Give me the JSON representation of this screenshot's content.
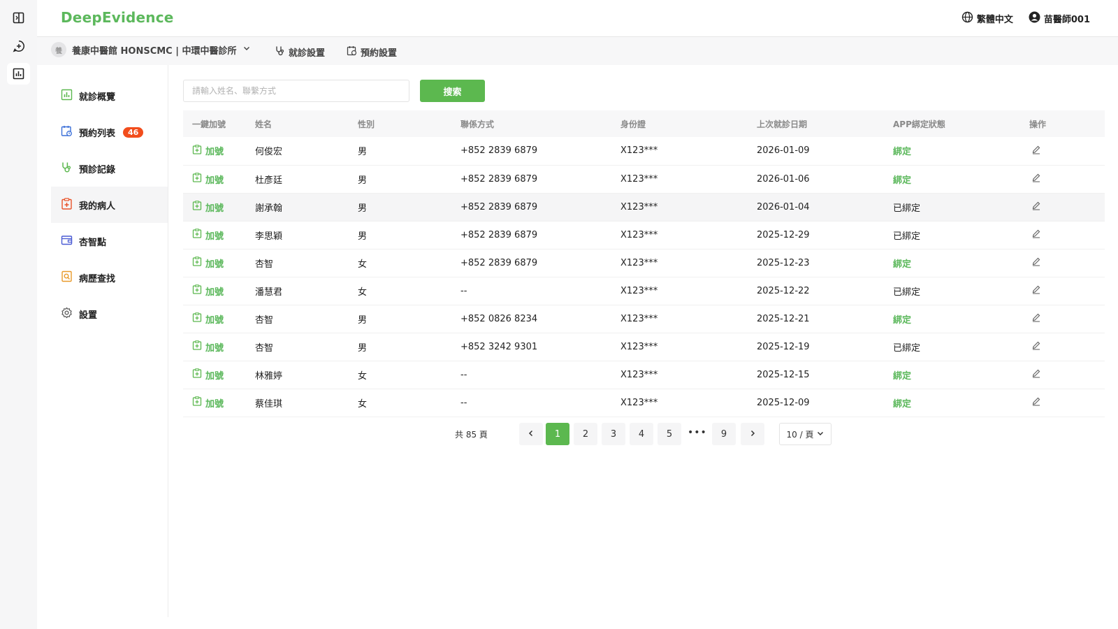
{
  "app": {
    "brand": "DeepEvidence"
  },
  "rail": {
    "items": [
      "panel-toggle-icon",
      "new-chat-icon",
      "chart-icon"
    ],
    "active": 2
  },
  "topbar": {
    "language": "繁體中文",
    "user": "苗醫師001"
  },
  "subbar": {
    "clinic": "養康中醫館 HONSCMC | 中環中醫診所",
    "clinic_logo": "養",
    "visit_settings": "就診設置",
    "appointment_settings": "預約設置"
  },
  "sidebar": {
    "items": [
      {
        "label": "就診概覽",
        "icon": "chart-icon"
      },
      {
        "label": "預約列表",
        "icon": "calendar-icon",
        "badge": "46"
      },
      {
        "label": "預診記錄",
        "icon": "stethoscope-icon"
      },
      {
        "label": "我的病人",
        "icon": "clipboard-plus-icon",
        "active": true
      },
      {
        "label": "杏智點",
        "icon": "wallet-icon"
      },
      {
        "label": "病歷查找",
        "icon": "document-search-icon"
      },
      {
        "label": "設置",
        "icon": "gear-icon"
      }
    ]
  },
  "search": {
    "placeholder": "請輸入姓名、聯繫方式",
    "button": "搜索"
  },
  "table": {
    "headers": [
      "一鍵加號",
      "姓名",
      "性別",
      "聯係方式",
      "身份證",
      "上次就診日期",
      "APP綁定狀態",
      "操作"
    ],
    "add_label": "加號",
    "rows": [
      {
        "name": "何俊宏",
        "gender": "男",
        "phone": "+852 2839 6879",
        "id": "X123***",
        "last_visit": "2026-01-09",
        "status": "綁定",
        "bound": false
      },
      {
        "name": "杜彥廷",
        "gender": "男",
        "phone": "+852 2839 6879",
        "id": "X123***",
        "last_visit": "2026-01-06",
        "status": "綁定",
        "bound": false
      },
      {
        "name": "謝承翰",
        "gender": "男",
        "phone": "+852 2839 6879",
        "id": "X123***",
        "last_visit": "2026-01-04",
        "status": "已綁定",
        "bound": true
      },
      {
        "name": "李思穎",
        "gender": "男",
        "phone": "+852 2839 6879",
        "id": "X123***",
        "last_visit": "2025-12-29",
        "status": "已綁定",
        "bound": true
      },
      {
        "name": "杏智",
        "gender": "女",
        "phone": "+852 2839 6879",
        "id": "X123***",
        "last_visit": "2025-12-23",
        "status": "綁定",
        "bound": false
      },
      {
        "name": "潘慧君",
        "gender": "女",
        "phone": "--",
        "id": "X123***",
        "last_visit": "2025-12-22",
        "status": "已綁定",
        "bound": true
      },
      {
        "name": "杏智",
        "gender": "男",
        "phone": "+852 0826 8234",
        "id": "X123***",
        "last_visit": "2025-12-21",
        "status": "綁定",
        "bound": false
      },
      {
        "name": "杏智",
        "gender": "男",
        "phone": "+852 3242 9301",
        "id": "X123***",
        "last_visit": "2025-12-19",
        "status": "已綁定",
        "bound": true
      },
      {
        "name": "林雅婷",
        "gender": "女",
        "phone": "--",
        "id": "X123***",
        "last_visit": "2025-12-15",
        "status": "綁定",
        "bound": false
      },
      {
        "name": "蔡佳琪",
        "gender": "女",
        "phone": "--",
        "id": "X123***",
        "last_visit": "2025-12-09",
        "status": "綁定",
        "bound": false
      }
    ]
  },
  "pagination": {
    "total": "共 85 頁",
    "pages": [
      "1",
      "2",
      "3",
      "4",
      "5",
      "9"
    ],
    "current": "1",
    "ellipsis": "•••",
    "page_size": "10 / 頁"
  },
  "colors": {
    "accent": "#5cb84f",
    "badge": "#f24d1c"
  }
}
